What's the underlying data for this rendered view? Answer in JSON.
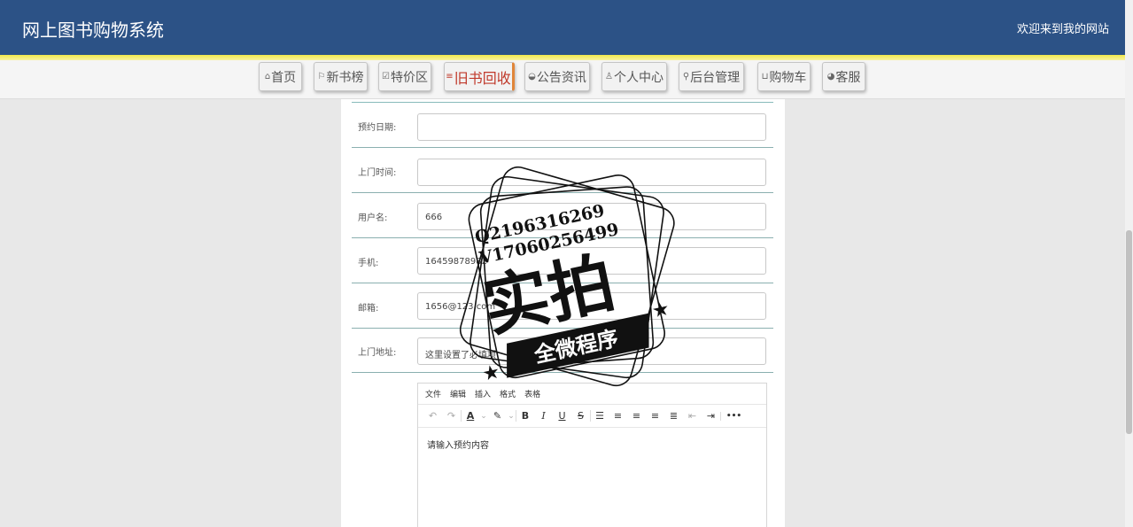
{
  "header": {
    "title": "网上图书购物系统",
    "welcome": "欢迎来到我的网站"
  },
  "nav": {
    "items": [
      {
        "label": "首页",
        "icon": "home-icon",
        "glyph": "⌂"
      },
      {
        "label": "新书榜",
        "icon": "flag-icon",
        "glyph": "⚐"
      },
      {
        "label": "特价区",
        "icon": "tag-icon",
        "glyph": "☑"
      },
      {
        "label": "旧书回收",
        "icon": "list-icon",
        "glyph": "≡"
      },
      {
        "label": "公告资讯",
        "icon": "book-icon",
        "glyph": "◒"
      },
      {
        "label": "个人中心",
        "icon": "user-icon",
        "glyph": "♙"
      },
      {
        "label": "后台管理",
        "icon": "link-icon",
        "glyph": "⚲"
      },
      {
        "label": "购物车",
        "icon": "cart-icon",
        "glyph": "⊔"
      },
      {
        "label": "客服",
        "icon": "chat-icon",
        "glyph": "◕"
      }
    ]
  },
  "form": {
    "rows": [
      {
        "label": "预约日期:",
        "value": ""
      },
      {
        "label": "上门时间:",
        "value": ""
      },
      {
        "label": "用户名:",
        "value": "666"
      },
      {
        "label": "手机:",
        "value": "16459878982"
      },
      {
        "label": "邮箱:",
        "value": "1656@123.com"
      },
      {
        "label": "上门地址:",
        "value": "这里设置了必填项"
      }
    ]
  },
  "editor": {
    "menu": [
      "文件",
      "编辑",
      "插入",
      "格式",
      "表格"
    ],
    "tools": {
      "undo": "↶",
      "redo": "↷",
      "font_color": "A",
      "font_color_caret": "⌄",
      "highlight": "✎",
      "highlight_caret": "⌄",
      "bold": "B",
      "italic": "I",
      "underline": "U",
      "strike": "S",
      "line_height": "☰",
      "align_left": "≡",
      "align_center": "≡",
      "align_right": "≡",
      "justify": "≣",
      "outdent": "⇤",
      "indent": "⇥",
      "more": "•••"
    },
    "placeholder": "请输入预约内容"
  },
  "stamp": {
    "line1": "Q2196316269",
    "line2": "V17060256499",
    "big": "实拍",
    "banner": "全微程序"
  },
  "colors": {
    "header_bg": "#2c5286",
    "accent_active": "#c0392b",
    "active_border": "#e0863a",
    "yellow": "#f0e74a"
  }
}
